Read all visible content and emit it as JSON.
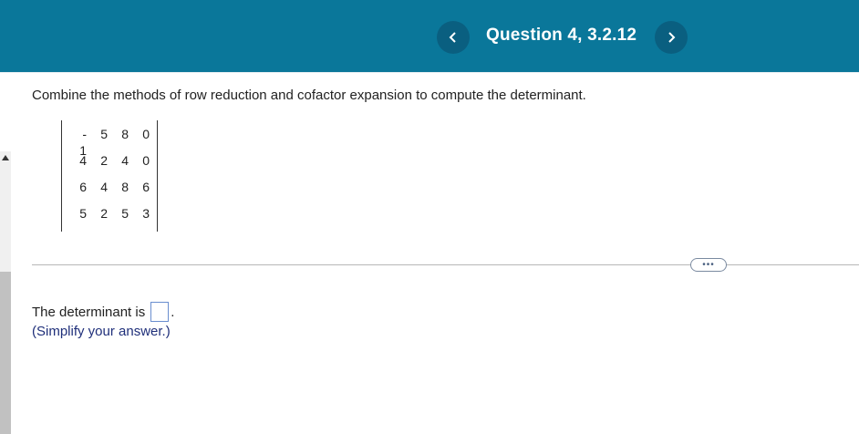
{
  "header": {
    "title": "Question 4, 3.2.12",
    "prev_icon": "chevron-left-icon",
    "next_icon": "chevron-right-icon",
    "color": "#0a779a"
  },
  "question": {
    "instructions": "Combine the methods of row reduction and cofactor expansion to compute the determinant.",
    "matrix": [
      [
        "- 1",
        "5",
        "8",
        "0"
      ],
      [
        "4",
        "2",
        "4",
        "0"
      ],
      [
        "6",
        "4",
        "8",
        "6"
      ],
      [
        "5",
        "2",
        "5",
        "3"
      ]
    ]
  },
  "more_button": {
    "label": "•••"
  },
  "answer": {
    "prefix": "The determinant is",
    "value": "",
    "suffix": ".",
    "hint": "(Simplify your answer.)"
  }
}
